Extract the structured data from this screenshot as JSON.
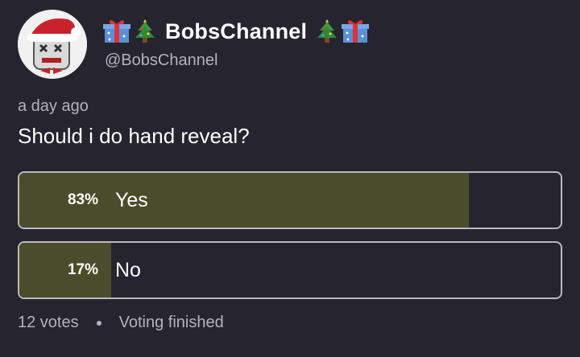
{
  "post": {
    "channel_name": "BobsChannel",
    "handle": "@BobsChannel",
    "timestamp": "a day ago",
    "question": "Should i do hand reveal?",
    "name_decorations": [
      "gift-icon",
      "christmas-tree-icon",
      "christmas-tree-icon",
      "gift-icon"
    ]
  },
  "poll": {
    "options": [
      {
        "percent_label": "83%",
        "label": "Yes",
        "percent": 83
      },
      {
        "percent_label": "17%",
        "label": "No",
        "percent": 17
      }
    ],
    "votes_label": "12 votes",
    "status": "Voting finished"
  },
  "colors": {
    "background": "#26242e",
    "fill": "#4a4d2b",
    "border": "#b9b9bf",
    "muted_text": "#b3b3b8"
  }
}
